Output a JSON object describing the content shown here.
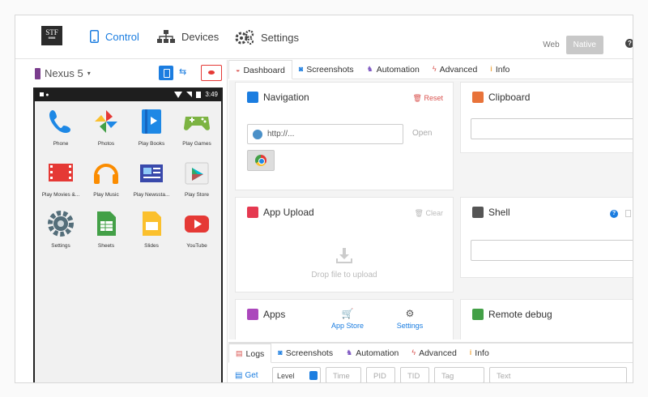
{
  "topnav": {
    "logo_text": "STF",
    "items": [
      {
        "label": "Control",
        "icon": "phone-icon"
      },
      {
        "label": "Devices",
        "icon": "sitemap-icon"
      },
      {
        "label": "Settings",
        "icon": "gears-icon"
      }
    ],
    "web_label": "Web",
    "native_label": "Native",
    "help_label": "?"
  },
  "device": {
    "name": "Nexus 5",
    "status_time": "3:49"
  },
  "apps": [
    {
      "label": "Phone",
      "icon": "phone-app-icon",
      "color": "#1e88e5"
    },
    {
      "label": "Photos",
      "icon": "photos-app-icon",
      "color": "#fbc02d"
    },
    {
      "label": "Play Books",
      "icon": "play-books-icon",
      "color": "#1e88e5"
    },
    {
      "label": "Play Games",
      "icon": "play-games-icon",
      "color": "#7cb342"
    },
    {
      "label": "Play Movies &...",
      "icon": "play-movies-icon",
      "color": "#e53935"
    },
    {
      "label": "Play Music",
      "icon": "play-music-icon",
      "color": "#fb8c00"
    },
    {
      "label": "Play Newssta...",
      "icon": "play-newsstand-icon",
      "color": "#3949ab"
    },
    {
      "label": "Play Store",
      "icon": "play-store-icon",
      "color": "#eeeeee"
    },
    {
      "label": "Settings",
      "icon": "settings-app-icon",
      "color": "#546e7a"
    },
    {
      "label": "Sheets",
      "icon": "sheets-app-icon",
      "color": "#43a047"
    },
    {
      "label": "Slides",
      "icon": "slides-app-icon",
      "color": "#fbc02d"
    },
    {
      "label": "YouTube",
      "icon": "youtube-app-icon",
      "color": "#e53935"
    }
  ],
  "tabs": [
    {
      "label": "Dashboard",
      "icon": "dashboard-icon",
      "color": "#d9534f"
    },
    {
      "label": "Screenshots",
      "icon": "camera-icon",
      "color": "#1b7de0"
    },
    {
      "label": "Automation",
      "icon": "automation-icon",
      "color": "#7e57c2"
    },
    {
      "label": "Advanced",
      "icon": "bolt-icon",
      "color": "#d9534f"
    },
    {
      "label": "Info",
      "icon": "info-icon",
      "color": "#f0ad4e"
    }
  ],
  "navigation": {
    "title": "Navigation",
    "reset_label": "Reset",
    "url_placeholder": "http://...",
    "open_label": "Open"
  },
  "clipboard": {
    "title": "Clipboard"
  },
  "upload": {
    "title": "App Upload",
    "clear_label": "Clear",
    "drop_label": "Drop file to upload"
  },
  "shell": {
    "title": "Shell",
    "help_label": "?"
  },
  "apps_card": {
    "title": "Apps",
    "app_store_label": "App Store",
    "settings_label": "Settings"
  },
  "remote_debug": {
    "title": "Remote debug"
  },
  "logs": {
    "tabs": [
      {
        "label": "Logs",
        "icon": "logs-icon",
        "color": "#d9534f"
      },
      {
        "label": "Screenshots",
        "icon": "camera-icon",
        "color": "#1b7de0"
      },
      {
        "label": "Automation",
        "icon": "automation-icon",
        "color": "#7e57c2"
      },
      {
        "label": "Advanced",
        "icon": "bolt-icon",
        "color": "#d9534f"
      },
      {
        "label": "Info",
        "icon": "info-icon",
        "color": "#f0ad4e"
      }
    ],
    "get_label": "Get",
    "level_label": "Level",
    "fields": [
      "Time",
      "PID",
      "TID",
      "Tag",
      "Text"
    ]
  },
  "colors": {
    "accent": "#1b7de0",
    "danger": "#d9534f"
  }
}
